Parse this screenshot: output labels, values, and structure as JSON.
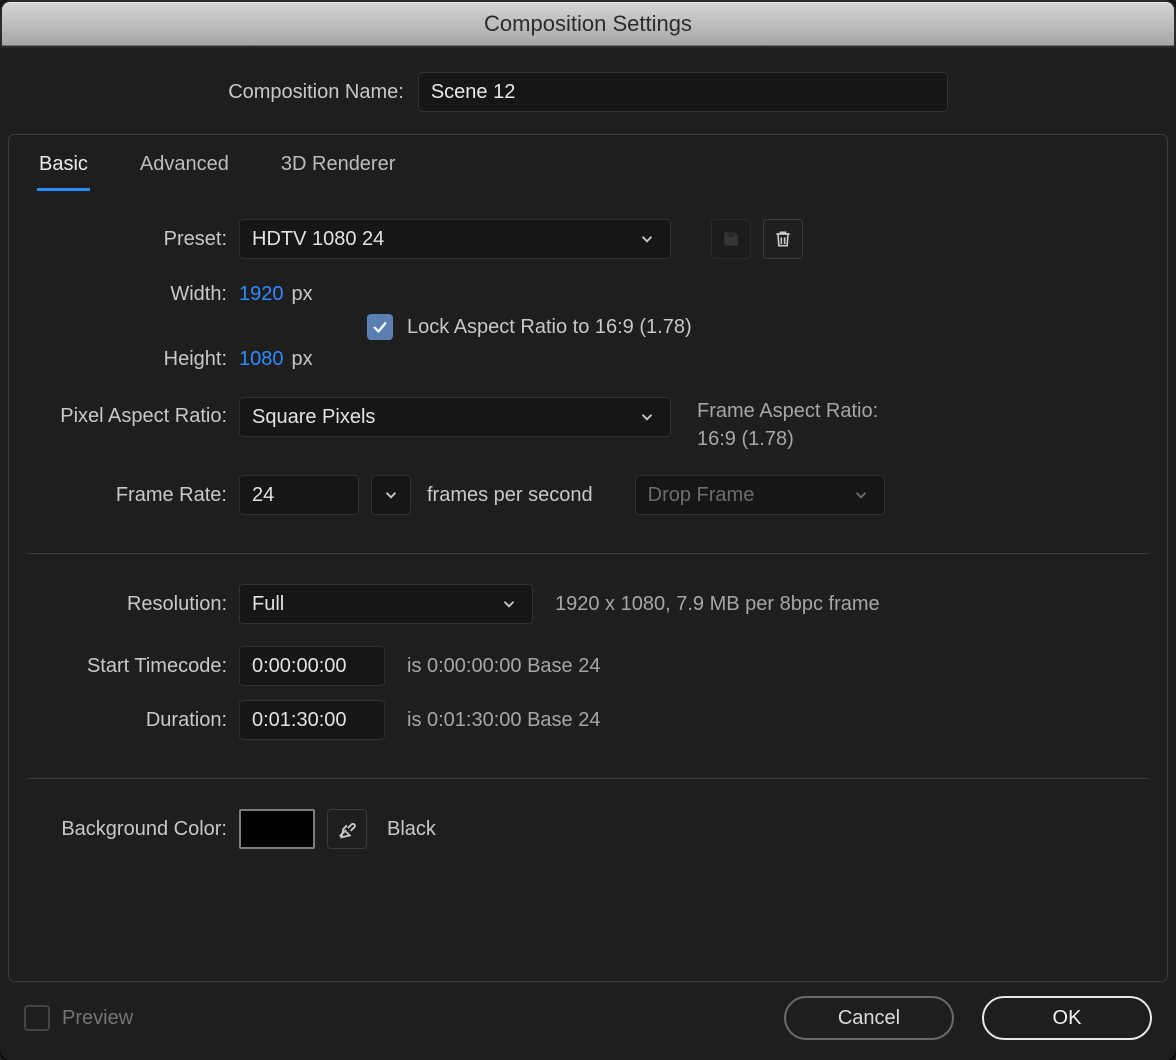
{
  "title": "Composition Settings",
  "name_row": {
    "label": "Composition Name:",
    "value": "Scene 12"
  },
  "tabs": {
    "basic": "Basic",
    "advanced": "Advanced",
    "renderer": "3D Renderer",
    "active": "basic"
  },
  "preset": {
    "label": "Preset:",
    "value": "HDTV 1080 24"
  },
  "width": {
    "label": "Width:",
    "value": "1920",
    "unit": "px"
  },
  "height": {
    "label": "Height:",
    "value": "1080",
    "unit": "px"
  },
  "lock": {
    "checked": true,
    "label": "Lock Aspect Ratio to 16:9 (1.78)"
  },
  "par": {
    "label": "Pixel Aspect Ratio:",
    "value": "Square Pixels",
    "far_label": "Frame Aspect Ratio:",
    "far_value": "16:9 (1.78)"
  },
  "fps": {
    "label": "Frame Rate:",
    "value": "24",
    "unit": "frames per second",
    "drop_value": "Drop Frame",
    "drop_enabled": false
  },
  "resolution": {
    "label": "Resolution:",
    "value": "Full",
    "info": "1920 x 1080, 7.9 MB per 8bpc frame"
  },
  "start_tc": {
    "label": "Start Timecode:",
    "value": "0:00:00:00",
    "info": "is 0:00:00:00  Base 24"
  },
  "duration": {
    "label": "Duration:",
    "value": "0:01:30:00",
    "info": "is 0:01:30:00  Base 24"
  },
  "bg": {
    "label": "Background Color:",
    "color": "#000000",
    "name": "Black"
  },
  "footer": {
    "preview": "Preview",
    "cancel": "Cancel",
    "ok": "OK"
  }
}
